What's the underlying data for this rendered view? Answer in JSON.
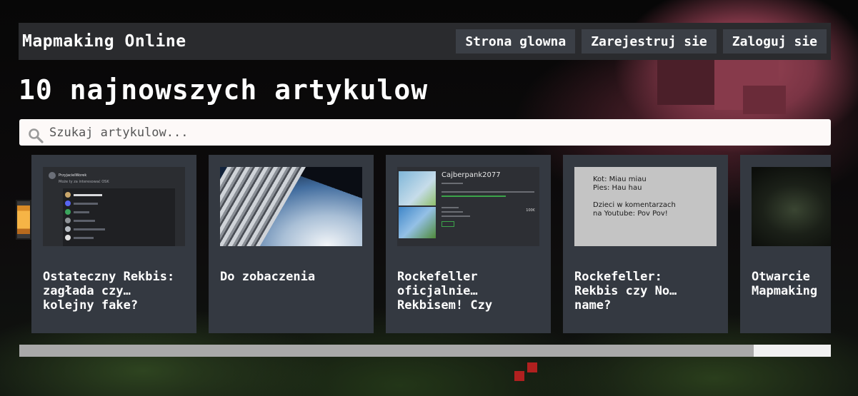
{
  "navbar": {
    "brand": "Mapmaking Online",
    "links": [
      {
        "label": "Strona glowna"
      },
      {
        "label": "Zarejestruj sie"
      },
      {
        "label": "Zaloguj sie"
      }
    ]
  },
  "page_title": "10 najnowszych artykulow",
  "search": {
    "placeholder": "Szukaj artykulow...",
    "value": ""
  },
  "articles": [
    {
      "title": "Ostateczny Rekbis:\nzagłada czy…\nkolejny fake?",
      "thumb": "discord-screenshot",
      "thumb_text": {
        "user": "PrzyjacielWorek",
        "status": "Może ty za interesować OSK"
      }
    },
    {
      "title": "Do zobaczenia",
      "thumb": "space-rocket"
    },
    {
      "title": "Rockefeller\noficjalnie…\nRekbisem! Czy",
      "thumb": "cyberpank-listing",
      "thumb_text": {
        "name": "Cajberpank2077",
        "price": "100€"
      }
    },
    {
      "title": "Rockefeller:\nRekbis czy No…\nname?",
      "thumb": "text-note",
      "thumb_text": {
        "note": "Kot: Miau miau\nPies: Hau hau\n\nDzieci w komentarzach\nna Youtube: Pov Pov!"
      }
    },
    {
      "title": "Otwarcie\nMapmaking",
      "thumb": "night-scene"
    }
  ],
  "scrollbar": {
    "position": 0,
    "visible_fraction": 0.905
  }
}
